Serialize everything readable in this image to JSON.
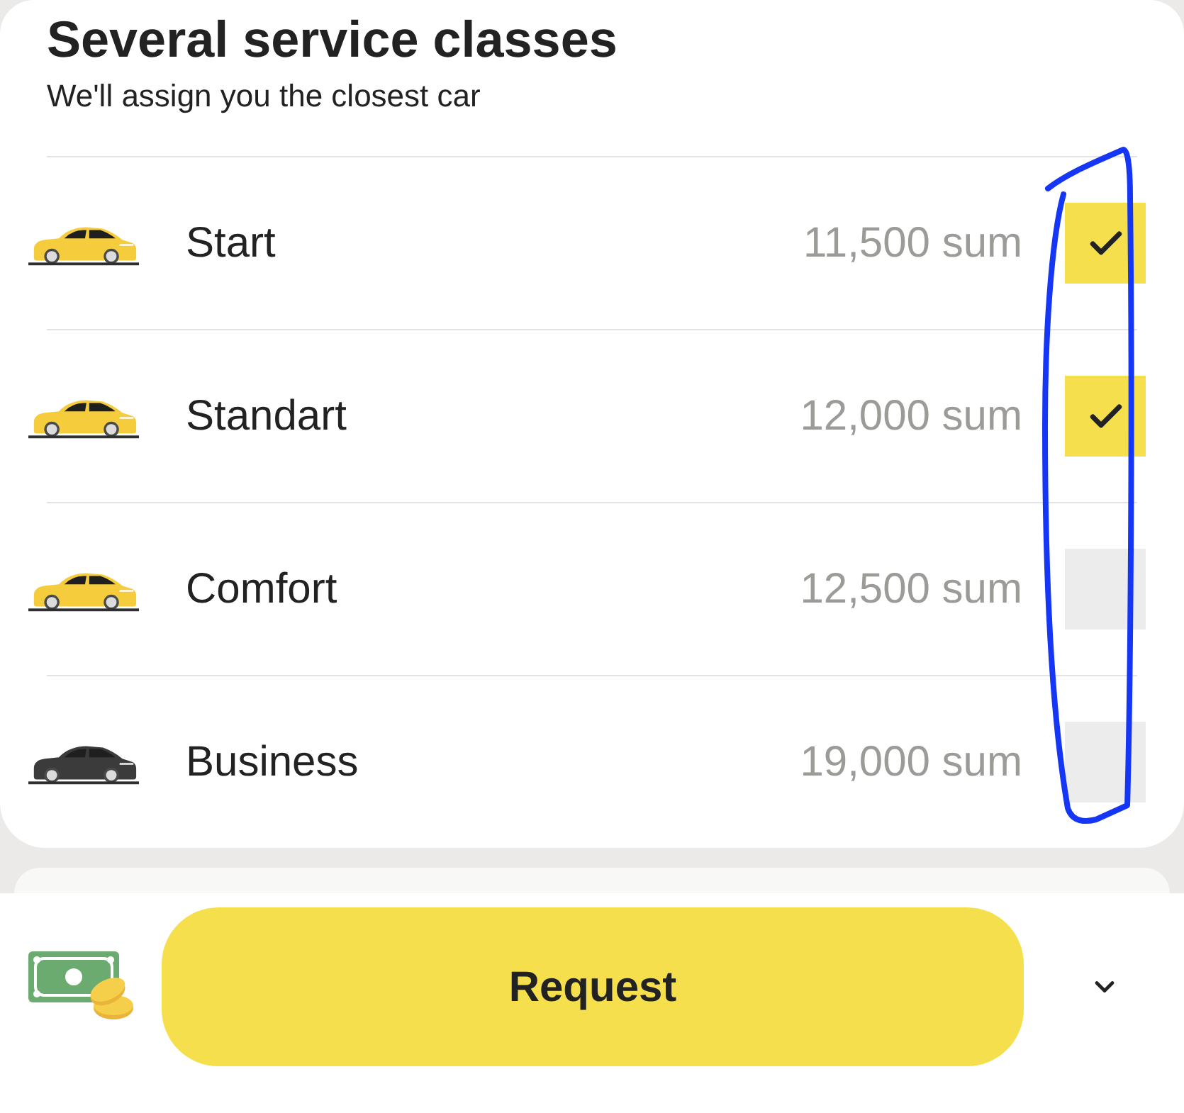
{
  "header": {
    "title": "Several service classes",
    "subtitle": "We'll assign you the closest car"
  },
  "service_classes": [
    {
      "name": "Start",
      "price": "11,500 sum",
      "checked": true,
      "color": "#f5cd3c"
    },
    {
      "name": "Standart",
      "price": "12,000 sum",
      "checked": true,
      "color": "#f5cd3c"
    },
    {
      "name": "Comfort",
      "price": "12,500 sum",
      "checked": false,
      "color": "#f5cd3c"
    },
    {
      "name": "Business",
      "price": "19,000 sum",
      "checked": false,
      "color": "#3b3b3b"
    }
  ],
  "footer": {
    "button": "Request"
  }
}
